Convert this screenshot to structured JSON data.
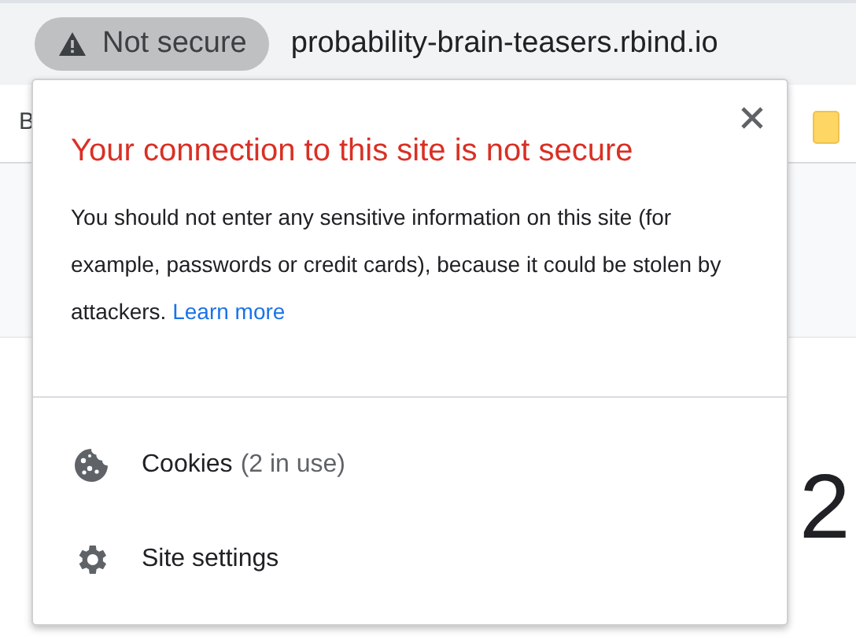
{
  "address_bar": {
    "security_chip": "Not secure",
    "url": "probability-brain-teasers.rbind.io"
  },
  "bookmarks_bar": {
    "item_partial": "B"
  },
  "page": {
    "heading_partial": "2"
  },
  "popup": {
    "title": "Your connection to this site is not secure",
    "message": "You should not enter any sensitive information on this site (for example, passwords or credit cards), because it could be stolen by attackers.",
    "link": "Learn more",
    "items": [
      {
        "kind": "cookies",
        "label": "Cookies",
        "detail": "(2 in use)"
      },
      {
        "kind": "settings",
        "label": "Site settings"
      }
    ]
  }
}
